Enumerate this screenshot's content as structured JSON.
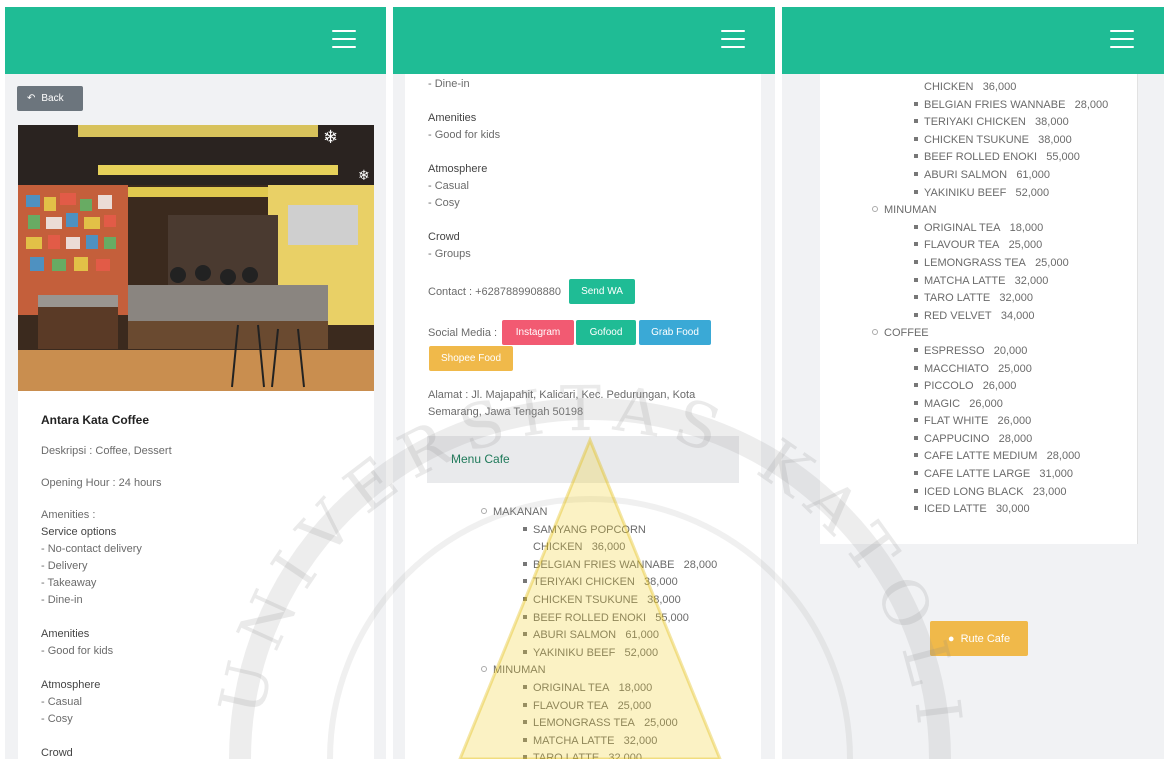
{
  "back_label": "Back",
  "cafe": {
    "name": "Antara Kata Coffee",
    "description": "Deskripsi : Coffee, Dessert",
    "opening": "Opening Hour : 24 hours",
    "amenities_label": "Amenities :",
    "service_title": "Service options",
    "service_items": [
      "- No-contact delivery",
      "- Delivery",
      "- Takeaway",
      "- Dine-in"
    ],
    "amenities_title": "Amenities",
    "amenities_items": [
      "- Good for kids"
    ],
    "atmosphere_title": "Atmosphere",
    "atmosphere_items": [
      "- Casual",
      "- Cosy"
    ],
    "crowd_title": "Crowd",
    "crowd_items": [
      "- Groups"
    ],
    "contact": "Contact : +6287889908880",
    "send_wa": "Send WA",
    "social_label": "Social Media :",
    "social": {
      "instagram": "Instagram",
      "gofood": "Gofood",
      "grabfood": "Grab Food",
      "shopeefood": "Shopee Food"
    },
    "address_line1": "Alamat : Jl. Majapahit, Kalicari, Kec. Pedurungan, Kota",
    "address_line2": "Semarang, Jawa Tengah 50198",
    "menu_title": "Menu Cafe",
    "route_label": "Rute Cafe"
  },
  "menu": {
    "makanan": "MAKANAN",
    "makanan_items": [
      [
        "SAMYANG POPCORN",
        "CHICKEN",
        "36,000"
      ],
      [
        "BELGIAN FRIES WANNABE",
        "28,000"
      ],
      [
        "TERIYAKI CHICKEN",
        "38,000"
      ],
      [
        "CHICKEN TSUKUNE",
        "38,000"
      ],
      [
        "BEEF ROLLED ENOKI",
        "55,000"
      ],
      [
        "ABURI SALMON",
        "61,000"
      ],
      [
        "YAKINIKU BEEF",
        "52,000"
      ]
    ],
    "minuman": "MINUMAN",
    "minuman_items": [
      [
        "ORIGINAL TEA",
        "18,000"
      ],
      [
        "FLAVOUR TEA",
        "25,000"
      ],
      [
        "LEMONGRASS TEA",
        "25,000"
      ],
      [
        "MATCHA LATTE",
        "32,000"
      ],
      [
        "TARO LATTE",
        "32,000"
      ],
      [
        "RED VELVET",
        "34,000"
      ]
    ],
    "coffee": "COFFEE",
    "coffee_items": [
      [
        "ESPRESSO",
        "20,000"
      ],
      [
        "MACCHIATO",
        "25,000"
      ],
      [
        "PICCOLO",
        "26,000"
      ],
      [
        "MAGIC",
        "26,000"
      ],
      [
        "FLAT WHITE",
        "26,000"
      ],
      [
        "CAPPUCINO",
        "28,000"
      ],
      [
        "CAFE LATTE MEDIUM",
        "28,000"
      ],
      [
        "CAFE LATTE LARGE",
        "31,000"
      ],
      [
        "ICED LONG BLACK",
        "23,000"
      ],
      [
        "ICED LATTE",
        "30,000"
      ]
    ]
  },
  "watermark_text": "UNIVERSITAS KATOLIK",
  "colors": {
    "navbar": "#1fbc95",
    "instagram": "#f25a72",
    "gofood": "#1fbc95",
    "grabfood": "#3aa9d6",
    "shopeefood": "#f0b94a",
    "route": "#f0b94a"
  }
}
